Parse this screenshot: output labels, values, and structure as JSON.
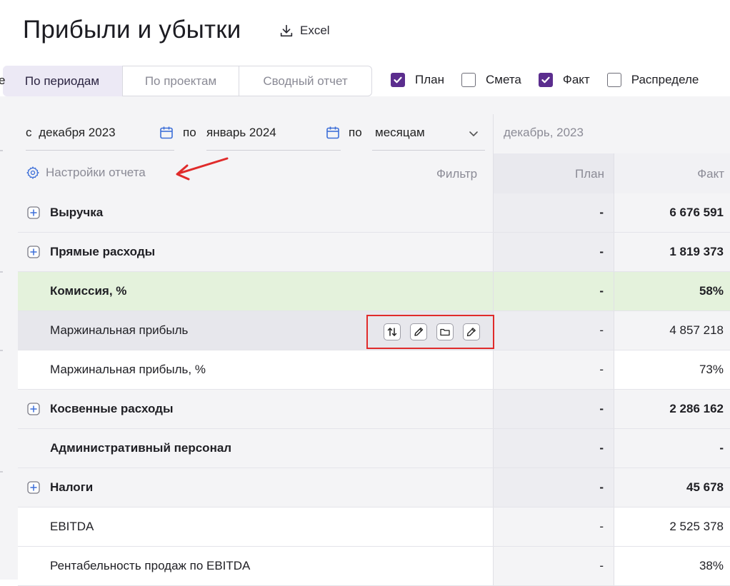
{
  "header": {
    "title": "Прибыли и убытки",
    "excel_label": "Excel"
  },
  "tabs": [
    {
      "label": "е",
      "active": false
    },
    {
      "label": "По периодам",
      "active": true
    },
    {
      "label": "По проектам",
      "active": false
    },
    {
      "label": "Сводный отчет",
      "active": false
    }
  ],
  "checkboxes": [
    {
      "label": "План",
      "checked": true
    },
    {
      "label": "Смета",
      "checked": false
    },
    {
      "label": "Факт",
      "checked": true
    },
    {
      "label": "Распределе",
      "checked": false
    }
  ],
  "filters": {
    "from_prefix": "с",
    "from_value": "декабря 2023",
    "to_prefix": "по",
    "to_value": "январь 2024",
    "by_prefix": "по",
    "by_value": "месяцам"
  },
  "settings_label": "Настройки отчета",
  "filter_label": "Фильтр",
  "period_label": "декабрь, 2023",
  "columns": {
    "plan": "План",
    "fact": "Факт"
  },
  "rows": [
    {
      "name": "Выручка",
      "plan": "-",
      "fact": "6 676 591",
      "bold": true,
      "expandable": true,
      "style": "grey"
    },
    {
      "name": "Прямые расходы",
      "plan": "-",
      "fact": "1 819 373",
      "bold": true,
      "expandable": true,
      "style": "grey"
    },
    {
      "name": "Комиссия, %",
      "plan": "-",
      "fact": "58%",
      "bold": true,
      "expandable": false,
      "style": "green"
    },
    {
      "name": "Маржинальная прибыль",
      "plan": "-",
      "fact": "4 857 218",
      "bold": false,
      "expandable": false,
      "style": "hover"
    },
    {
      "name": "Маржинальная прибыль, %",
      "plan": "-",
      "fact": "73%",
      "bold": false,
      "expandable": false,
      "style": "white"
    },
    {
      "name": "Косвенные расходы",
      "plan": "-",
      "fact": "2 286 162",
      "bold": true,
      "expandable": true,
      "style": "grey"
    },
    {
      "name": "Административный персонал",
      "plan": "-",
      "fact": "-",
      "bold": true,
      "expandable": false,
      "style": "grey"
    },
    {
      "name": "Налоги",
      "plan": "-",
      "fact": "45 678",
      "bold": true,
      "expandable": true,
      "style": "grey"
    },
    {
      "name": "EBITDA",
      "plan": "-",
      "fact": "2 525 378",
      "bold": false,
      "expandable": false,
      "style": "white"
    },
    {
      "name": "Рентабельность продаж по EBITDA",
      "plan": "-",
      "fact": "38%",
      "bold": false,
      "expandable": false,
      "style": "white"
    }
  ],
  "row_actions": [
    "sort-icon",
    "edit-pencil-icon",
    "folder-icon",
    "color-picker-icon"
  ],
  "colors": {
    "accent": "#5b2d8e",
    "highlight_green": "#e4f2dc",
    "annotation_red": "#e02b2b"
  }
}
